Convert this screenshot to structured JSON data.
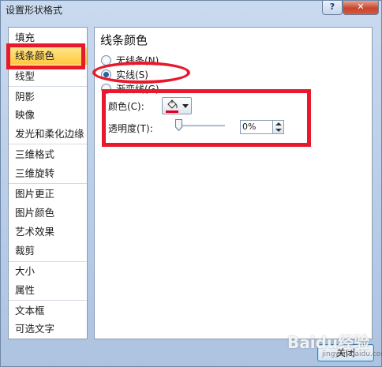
{
  "window": {
    "title": "设置形状格式",
    "help_glyph": "?",
    "close_glyph": "✕"
  },
  "nav": {
    "items": [
      {
        "label": "填充"
      },
      {
        "label": "线条颜色",
        "active": true
      },
      {
        "label": "线型"
      },
      {
        "label": "阴影"
      },
      {
        "label": "映像"
      },
      {
        "label": "发光和柔化边缘"
      },
      {
        "label": "三维格式"
      },
      {
        "label": "三维旋转"
      },
      {
        "label": "图片更正"
      },
      {
        "label": "图片颜色"
      },
      {
        "label": "艺术效果"
      },
      {
        "label": "裁剪"
      },
      {
        "label": "大小"
      },
      {
        "label": "属性"
      },
      {
        "label": "文本框"
      },
      {
        "label": "可选文字"
      }
    ]
  },
  "panel": {
    "title": "线条颜色",
    "options": [
      {
        "label": "无线条(N)",
        "checked": false
      },
      {
        "label": "实线(S)",
        "checked": true
      },
      {
        "label": "渐变线(G)",
        "checked": false
      }
    ],
    "color_label": "颜色(C):",
    "color_value": "#e0001b",
    "color_icon": "paint-bucket-icon",
    "transparency_label": "透明度(T):",
    "transparency_value": "0%",
    "transparency_fraction": 0
  },
  "footer": {
    "close_label": "关闭"
  },
  "watermark": {
    "text": "Baidu经验",
    "sub": "jingyan.baidu.com"
  },
  "colors": {
    "annotation": "#e8192c",
    "active_item": "#ffc83c"
  }
}
